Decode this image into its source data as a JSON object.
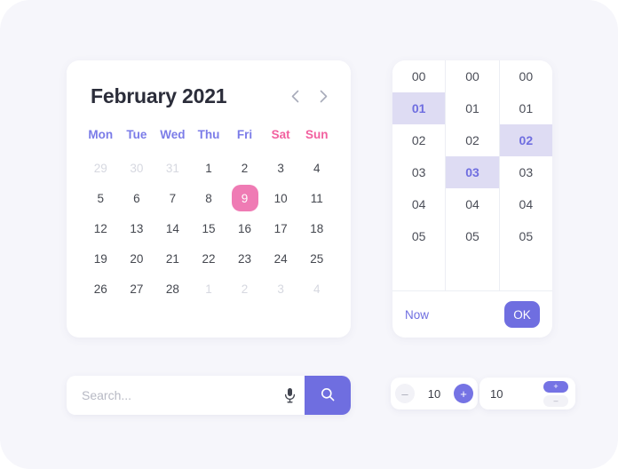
{
  "theme": {
    "background": "#f6f6fb",
    "accent_purple": "#6f6ee0",
    "accent_pink": "#ef7bb4",
    "weekday_purple": "#7b7ce8",
    "weekend_pink": "#f2609f",
    "highlight_lavender": "#dedcf3",
    "title_color": "#2b2d3a"
  },
  "calendar": {
    "title": "February 2021",
    "prev_label": "‹",
    "next_label": "›",
    "weekdays": [
      {
        "label": "Mon",
        "weekend": false
      },
      {
        "label": "Tue",
        "weekend": false
      },
      {
        "label": "Wed",
        "weekend": false
      },
      {
        "label": "Thu",
        "weekend": false
      },
      {
        "label": "Fri",
        "weekend": false
      },
      {
        "label": "Sat",
        "weekend": true
      },
      {
        "label": "Sun",
        "weekend": true
      }
    ],
    "days": [
      {
        "label": "29",
        "muted": true,
        "selected": false
      },
      {
        "label": "30",
        "muted": true,
        "selected": false
      },
      {
        "label": "31",
        "muted": true,
        "selected": false
      },
      {
        "label": "1",
        "muted": false,
        "selected": false
      },
      {
        "label": "2",
        "muted": false,
        "selected": false
      },
      {
        "label": "3",
        "muted": false,
        "selected": false
      },
      {
        "label": "4",
        "muted": false,
        "selected": false
      },
      {
        "label": "5",
        "muted": false,
        "selected": false
      },
      {
        "label": "6",
        "muted": false,
        "selected": false
      },
      {
        "label": "7",
        "muted": false,
        "selected": false
      },
      {
        "label": "8",
        "muted": false,
        "selected": false
      },
      {
        "label": "9",
        "muted": false,
        "selected": true
      },
      {
        "label": "10",
        "muted": false,
        "selected": false
      },
      {
        "label": "11",
        "muted": false,
        "selected": false
      },
      {
        "label": "12",
        "muted": false,
        "selected": false
      },
      {
        "label": "13",
        "muted": false,
        "selected": false
      },
      {
        "label": "14",
        "muted": false,
        "selected": false
      },
      {
        "label": "15",
        "muted": false,
        "selected": false
      },
      {
        "label": "16",
        "muted": false,
        "selected": false
      },
      {
        "label": "17",
        "muted": false,
        "selected": false
      },
      {
        "label": "18",
        "muted": false,
        "selected": false
      },
      {
        "label": "19",
        "muted": false,
        "selected": false
      },
      {
        "label": "20",
        "muted": false,
        "selected": false
      },
      {
        "label": "21",
        "muted": false,
        "selected": false
      },
      {
        "label": "22",
        "muted": false,
        "selected": false
      },
      {
        "label": "23",
        "muted": false,
        "selected": false
      },
      {
        "label": "24",
        "muted": false,
        "selected": false
      },
      {
        "label": "25",
        "muted": false,
        "selected": false
      },
      {
        "label": "26",
        "muted": false,
        "selected": false
      },
      {
        "label": "27",
        "muted": false,
        "selected": false
      },
      {
        "label": "28",
        "muted": false,
        "selected": false
      },
      {
        "label": "1",
        "muted": true,
        "selected": false
      },
      {
        "label": "2",
        "muted": true,
        "selected": false
      },
      {
        "label": "3",
        "muted": true,
        "selected": false
      },
      {
        "label": "4",
        "muted": true,
        "selected": false
      }
    ]
  },
  "time_picker": {
    "columns": [
      {
        "name": "hours",
        "selected": "01",
        "values": [
          "00",
          "01",
          "02",
          "03",
          "04",
          "05"
        ]
      },
      {
        "name": "minutes",
        "selected": "03",
        "values": [
          "00",
          "01",
          "02",
          "03",
          "04",
          "05"
        ]
      },
      {
        "name": "seconds",
        "selected": "02",
        "values": [
          "00",
          "01",
          "02",
          "03",
          "04",
          "05"
        ]
      }
    ],
    "now_label": "Now",
    "ok_label": "OK"
  },
  "search": {
    "placeholder": "Search...",
    "value": "",
    "mic_icon": "microphone-icon",
    "search_icon": "magnifier-icon"
  },
  "steppers": [
    {
      "name": "stepper-horizontal",
      "value": "10",
      "minus_label": "–",
      "plus_label": "+"
    },
    {
      "name": "stepper-vertical",
      "value": "10",
      "minus_label": "–",
      "plus_label": "+"
    }
  ]
}
